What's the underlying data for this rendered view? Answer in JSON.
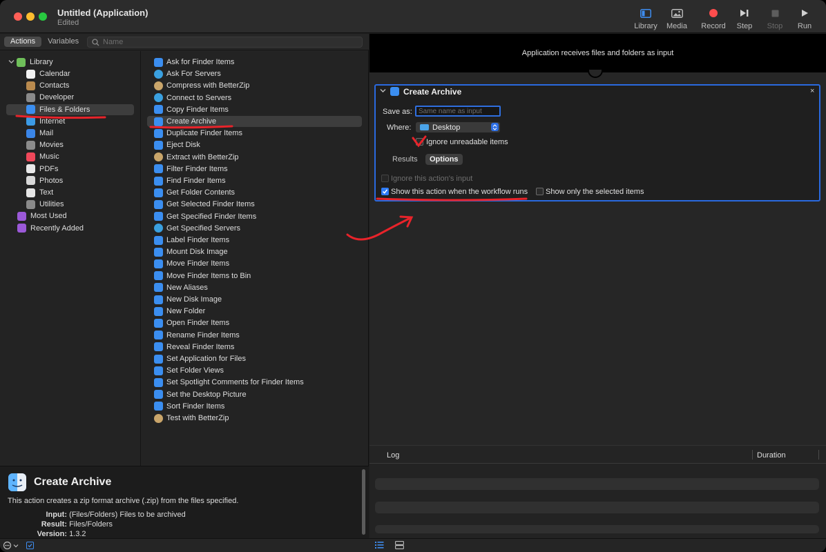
{
  "window": {
    "title": "Untitled (Application)",
    "subtitle": "Edited"
  },
  "toolbar": {
    "library": "Library",
    "media": "Media",
    "record": "Record",
    "step": "Step",
    "stop": "Stop",
    "run": "Run"
  },
  "left": {
    "tabs": {
      "actions": "Actions",
      "variables": "Variables"
    },
    "search_placeholder": "Name"
  },
  "library": {
    "root": "Library",
    "items": [
      {
        "label": "Calendar",
        "icon": "calendar-icon",
        "color": "#f1f1f1"
      },
      {
        "label": "Contacts",
        "icon": "contacts-icon",
        "color": "#b98a4e"
      },
      {
        "label": "Developer",
        "icon": "developer-icon",
        "color": "#8a8a8a"
      },
      {
        "label": "Files & Folders",
        "icon": "finder-icon",
        "color": "#3b8ef0"
      },
      {
        "label": "Internet",
        "icon": "internet-icon",
        "color": "#3c9be6"
      },
      {
        "label": "Mail",
        "icon": "mail-icon",
        "color": "#3b86e8"
      },
      {
        "label": "Movies",
        "icon": "movies-icon",
        "color": "#8b8b8b"
      },
      {
        "label": "Music",
        "icon": "music-icon",
        "color": "#f0485a"
      },
      {
        "label": "PDFs",
        "icon": "pdf-icon",
        "color": "#e9e9e9"
      },
      {
        "label": "Photos",
        "icon": "photos-icon",
        "color": "#d8d8d8"
      },
      {
        "label": "Text",
        "icon": "text-icon",
        "color": "#e6e6e6"
      },
      {
        "label": "Utilities",
        "icon": "utilities-icon",
        "color": "#8a8a8a"
      }
    ],
    "smart": [
      {
        "label": "Most Used",
        "icon": "smart-folder-icon",
        "color": "#9b59d8"
      },
      {
        "label": "Recently Added",
        "icon": "smart-folder-icon",
        "color": "#9b59d8"
      }
    ]
  },
  "actions": [
    "Ask for Finder Items",
    "Ask For Servers",
    "Compress with BetterZip",
    "Connect to Servers",
    "Copy Finder Items",
    "Create Archive",
    "Duplicate Finder Items",
    "Eject Disk",
    "Extract with BetterZip",
    "Filter Finder Items",
    "Find Finder Items",
    "Get Folder Contents",
    "Get Selected Finder Items",
    "Get Specified Finder Items",
    "Get Specified Servers",
    "Label Finder Items",
    "Mount Disk Image",
    "Move Finder Items",
    "Move Finder Items to Bin",
    "New Aliases",
    "New Disk Image",
    "New Folder",
    "Open Finder Items",
    "Rename Finder Items",
    "Reveal Finder Items",
    "Set Application for Files",
    "Set Folder Views",
    "Set Spotlight Comments for Finder Items",
    "Set the Desktop Picture",
    "Sort Finder Items",
    "Test with BetterZip"
  ],
  "description": {
    "title": "Create Archive",
    "text": "This action creates a zip format archive (.zip) from the files specified.",
    "input_label": "Input:",
    "input_value": "(Files/Folders) Files to be archived",
    "result_label": "Result:",
    "result_value": "Files/Folders",
    "version_label": "Version:",
    "version_value": "1.3.2"
  },
  "workflow": {
    "input_banner": "Application receives files and folders as input",
    "card": {
      "title": "Create Archive",
      "close": "×",
      "save_as_label": "Save as:",
      "save_as_placeholder": "Same name as input",
      "where_label": "Where:",
      "where_value": "Desktop",
      "ignore_unreadable": "Ignore unreadable items",
      "tab_results": "Results",
      "tab_options": "Options",
      "ignore_input": "Ignore this action's input",
      "show_when_runs": "Show this action when the workflow runs",
      "show_selected": "Show only the selected items"
    }
  },
  "log": {
    "log_header": "Log",
    "duration_header": "Duration"
  },
  "colors": {
    "accent": "#2f7cf6",
    "annotation": "#e8232a"
  }
}
